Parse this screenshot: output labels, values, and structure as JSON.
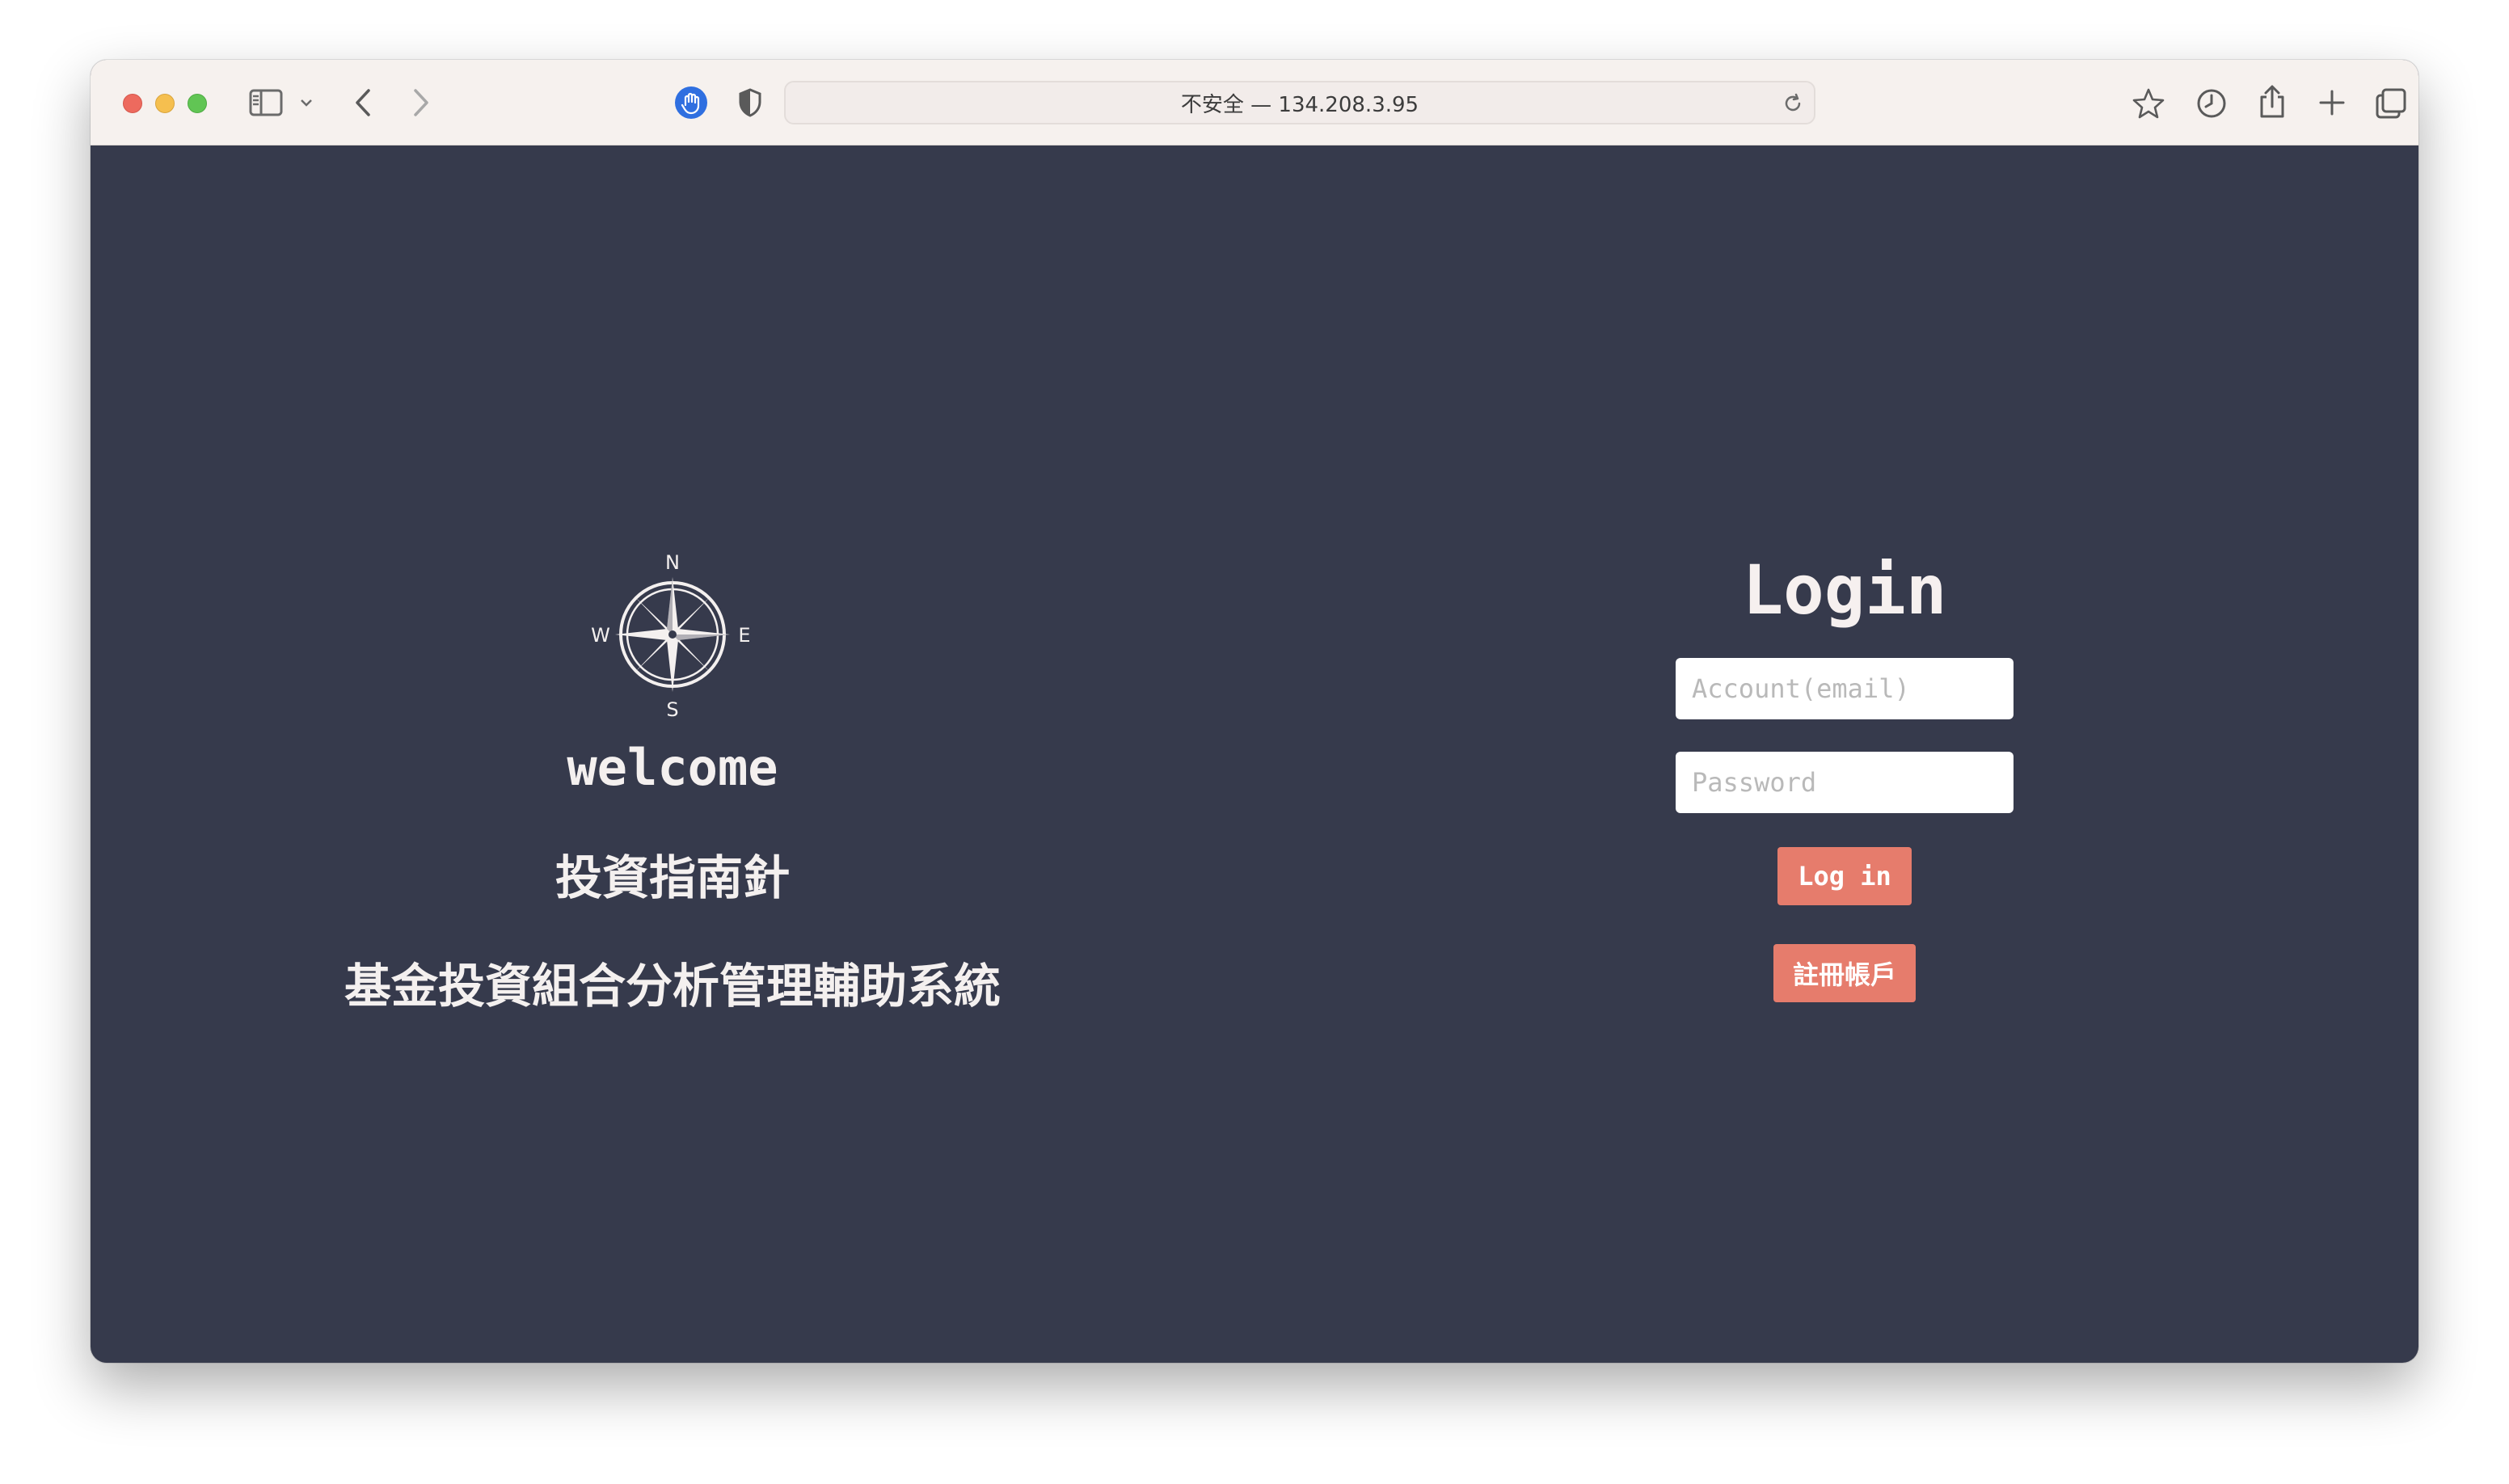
{
  "browser": {
    "address": "不安全 — 134.208.3.95",
    "icons": [
      "sidebar-icon",
      "chevron-down-icon",
      "back-icon",
      "forward-icon",
      "privacy-report-icon",
      "shield-icon",
      "reload-icon",
      "bookmark-star-icon",
      "history-clock-icon",
      "share-icon",
      "new-tab-icon",
      "tab-overview-icon"
    ]
  },
  "brand": {
    "compass_letters": {
      "north": "N",
      "south": "S",
      "east": "E",
      "west": "W"
    },
    "welcome": "welcome",
    "title": "投資指南針",
    "subtitle": "基金投資組合分析管理輔助系統"
  },
  "login": {
    "title": "Login",
    "account_placeholder": "Account(email)",
    "password_placeholder": "Password",
    "login_button": "Log in",
    "register_button": "註冊帳戶"
  },
  "colors": {
    "page_background": "#363a4c",
    "button": "#e67c6c",
    "text": "#f4f0ef"
  }
}
